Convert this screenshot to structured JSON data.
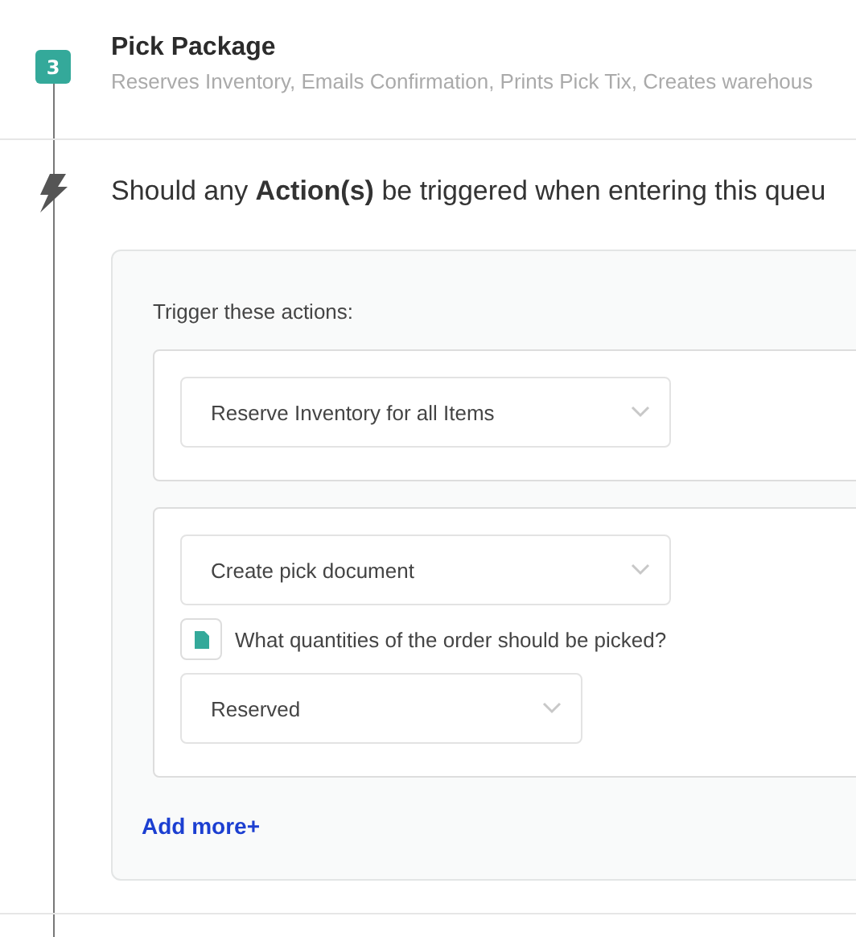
{
  "step": {
    "number": "3",
    "title": "Pick Package",
    "subtitle": "Reserves Inventory, Emails Confirmation, Prints Pick Tix, Creates warehous"
  },
  "trigger": {
    "question": "Should any **Action(s)** be triggered when entering this queu",
    "label": "Trigger these actions:",
    "actions": [
      {
        "value": "Reserve Inventory for all Items"
      },
      {
        "value": "Create pick document",
        "option": {
          "label": "What quantities of the order should be picked?",
          "value": "Reserved"
        }
      }
    ],
    "add_more": "Add more+"
  }
}
